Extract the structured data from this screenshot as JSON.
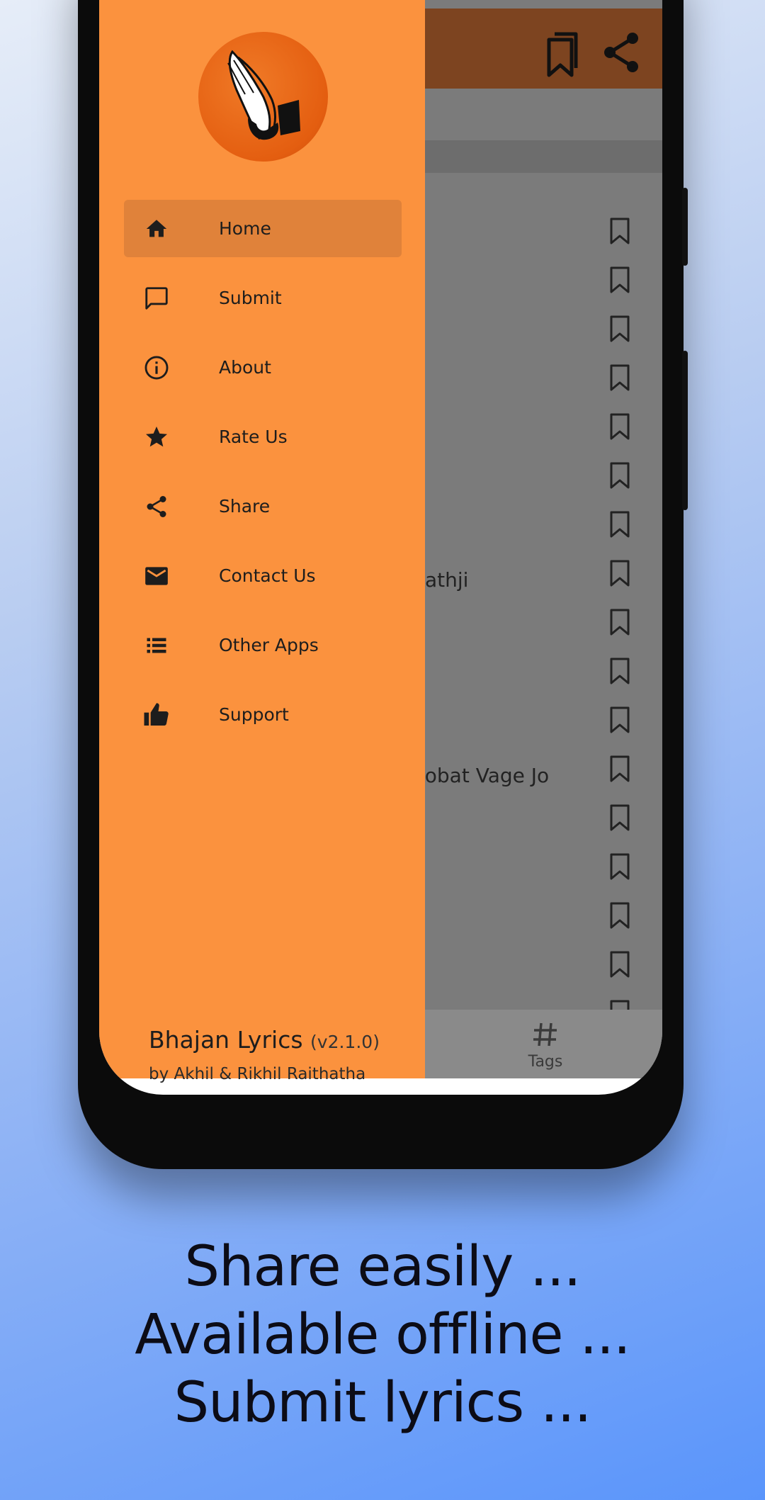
{
  "drawer": {
    "logo_icon": "praying-hands-icon",
    "items": [
      {
        "label": "Home",
        "icon": "home-icon",
        "active": true
      },
      {
        "label": "Submit",
        "icon": "chat-bubble-icon"
      },
      {
        "label": "About",
        "icon": "info-icon"
      },
      {
        "label": "Rate Us",
        "icon": "star-icon"
      },
      {
        "label": "Share",
        "icon": "share-icon"
      },
      {
        "label": "Contact Us",
        "icon": "mail-icon"
      },
      {
        "label": "Other Apps",
        "icon": "list-icon"
      },
      {
        "label": "Support",
        "icon": "thumbs-up-icon"
      }
    ],
    "footer": {
      "app_name": "Bhajan Lyrics",
      "version": "(v2.1.0)",
      "authors": "by Akhil & Rikhil Raithatha"
    }
  },
  "background_list": {
    "visible_fragments": [
      "athji",
      "lobat Vage Jo"
    ],
    "bookmark_count": 17
  },
  "bottom_nav": {
    "tags_label": "Tags"
  },
  "marketing": {
    "line1": "Share easily ...",
    "line2": "Available offline ...",
    "line3": "Submit lyrics ..."
  },
  "colors": {
    "drawer_bg": "#fb923e",
    "active_item_bg": "#e0823a",
    "app_bar": "#7d4420",
    "overlay": "#7b7b7b"
  }
}
